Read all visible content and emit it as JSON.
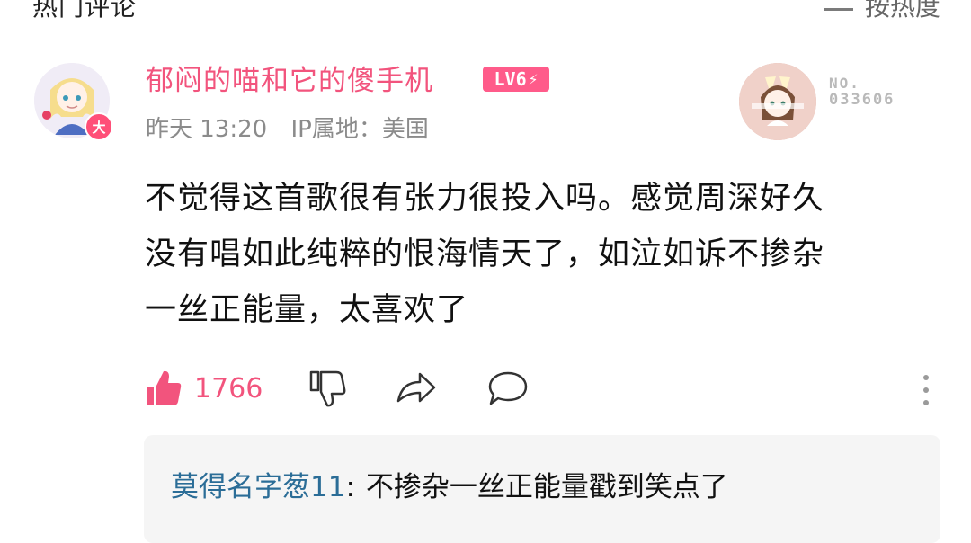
{
  "section": {
    "title": "热门评论",
    "sort_label": "按热度"
  },
  "comment": {
    "username": "郁闷的喵和它的傻手机",
    "level": "LV6",
    "avatar_badge": "大",
    "time": "昨天 13:20",
    "ip": "IP属地：美国",
    "medal_no_label": "NO.",
    "medal_no_value": "033606",
    "text": "不觉得这首歌很有张力很投入吗。感觉周深好久\n没有唱如此纯粹的恨海情天了，如泣如诉不掺杂\n一丝正能量，太喜欢了",
    "like_count": "1766"
  },
  "reply": {
    "user": "莫得名字葱11",
    "colon": ":",
    "text": "不掺杂一丝正能量戳到笑点了"
  },
  "icons": {
    "sort": "sort-lines-icon",
    "like": "thumbs-up-icon",
    "dislike": "thumbs-down-icon",
    "share": "share-icon",
    "reply": "comment-icon",
    "more": "more-vertical-icon"
  },
  "colors": {
    "pink": "#f2547d",
    "blue": "#2b6d97",
    "gray": "#8b8b8b"
  }
}
